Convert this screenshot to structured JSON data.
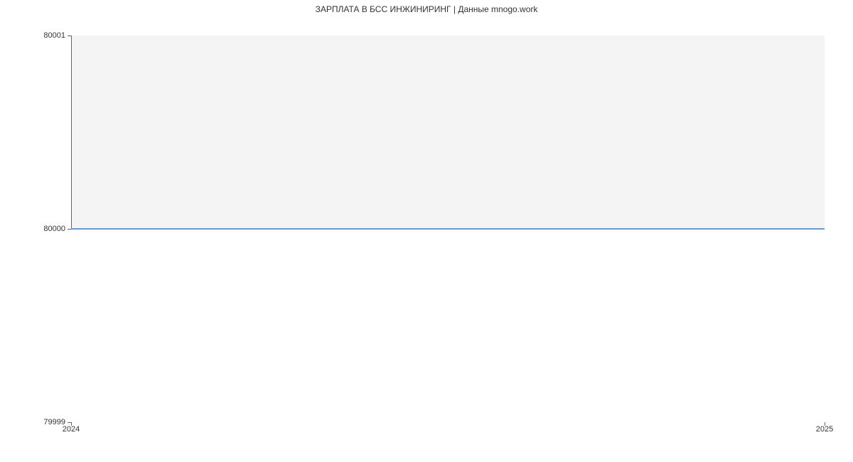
{
  "chart_data": {
    "type": "line",
    "title": "ЗАРПЛАТА В БСС ИНЖИНИРИНГ | Данные mnogo.work",
    "xlabel": "",
    "ylabel": "",
    "x": [
      2024,
      2025
    ],
    "series": [
      {
        "name": "salary",
        "values": [
          80000,
          80000
        ],
        "color": "#6699dd"
      }
    ],
    "ylim": [
      79999,
      80001
    ],
    "xlim": [
      2024,
      2025
    ],
    "y_ticks": [
      79999,
      80000,
      80001
    ],
    "x_ticks": [
      2024,
      2025
    ]
  },
  "yticks": {
    "t0": "79999",
    "t1": "80000",
    "t2": "80001"
  },
  "xticks": {
    "t0": "2024",
    "t1": "2025"
  }
}
